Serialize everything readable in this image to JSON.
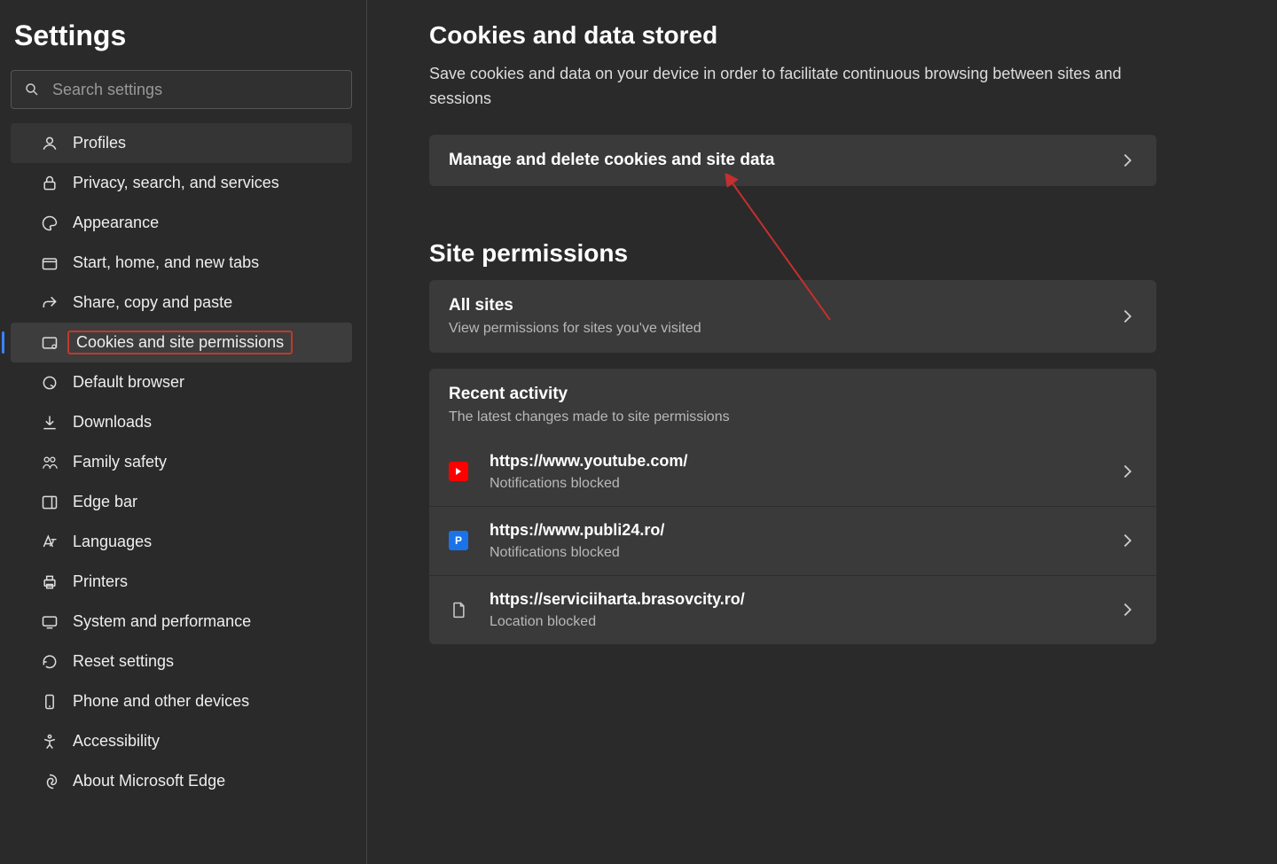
{
  "sidebar": {
    "title": "Settings",
    "search_placeholder": "Search settings",
    "items": [
      {
        "label": "Profiles",
        "icon": "profile",
        "active": false,
        "highlighted": false,
        "hovered": true
      },
      {
        "label": "Privacy, search, and services",
        "icon": "lock",
        "active": false,
        "highlighted": false
      },
      {
        "label": "Appearance",
        "icon": "palette",
        "active": false,
        "highlighted": false
      },
      {
        "label": "Start, home, and new tabs",
        "icon": "tabs",
        "active": false,
        "highlighted": false
      },
      {
        "label": "Share, copy and paste",
        "icon": "share",
        "active": false,
        "highlighted": false
      },
      {
        "label": "Cookies and site permissions",
        "icon": "cookies",
        "active": true,
        "highlighted": true
      },
      {
        "label": "Default browser",
        "icon": "default",
        "active": false,
        "highlighted": false
      },
      {
        "label": "Downloads",
        "icon": "download",
        "active": false,
        "highlighted": false
      },
      {
        "label": "Family safety",
        "icon": "family",
        "active": false,
        "highlighted": false
      },
      {
        "label": "Edge bar",
        "icon": "edgebar",
        "active": false,
        "highlighted": false
      },
      {
        "label": "Languages",
        "icon": "languages",
        "active": false,
        "highlighted": false
      },
      {
        "label": "Printers",
        "icon": "printers",
        "active": false,
        "highlighted": false
      },
      {
        "label": "System and performance",
        "icon": "system",
        "active": false,
        "highlighted": false
      },
      {
        "label": "Reset settings",
        "icon": "reset",
        "active": false,
        "highlighted": false
      },
      {
        "label": "Phone and other devices",
        "icon": "phone",
        "active": false,
        "highlighted": false
      },
      {
        "label": "Accessibility",
        "icon": "accessibility",
        "active": false,
        "highlighted": false
      },
      {
        "label": "About Microsoft Edge",
        "icon": "about",
        "active": false,
        "highlighted": false
      }
    ]
  },
  "content": {
    "cookies_section": {
      "title": "Cookies and data stored",
      "description": "Save cookies and data on your device in order to facilitate continuous browsing between sites and sessions",
      "manage_row": {
        "title": "Manage and delete cookies and site data"
      }
    },
    "permissions_section": {
      "title": "Site permissions",
      "all_sites": {
        "title": "All sites",
        "subtitle": "View permissions for sites you've visited"
      },
      "recent": {
        "header_title": "Recent activity",
        "header_subtitle": "The latest changes made to site permissions",
        "items": [
          {
            "url": "https://www.youtube.com/",
            "status": "Notifications blocked",
            "icon": "youtube"
          },
          {
            "url": "https://www.publi24.ro/",
            "status": "Notifications blocked",
            "icon": "publi"
          },
          {
            "url": "https://serviciiharta.brasovcity.ro/",
            "status": "Location blocked",
            "icon": "file"
          }
        ]
      }
    }
  }
}
